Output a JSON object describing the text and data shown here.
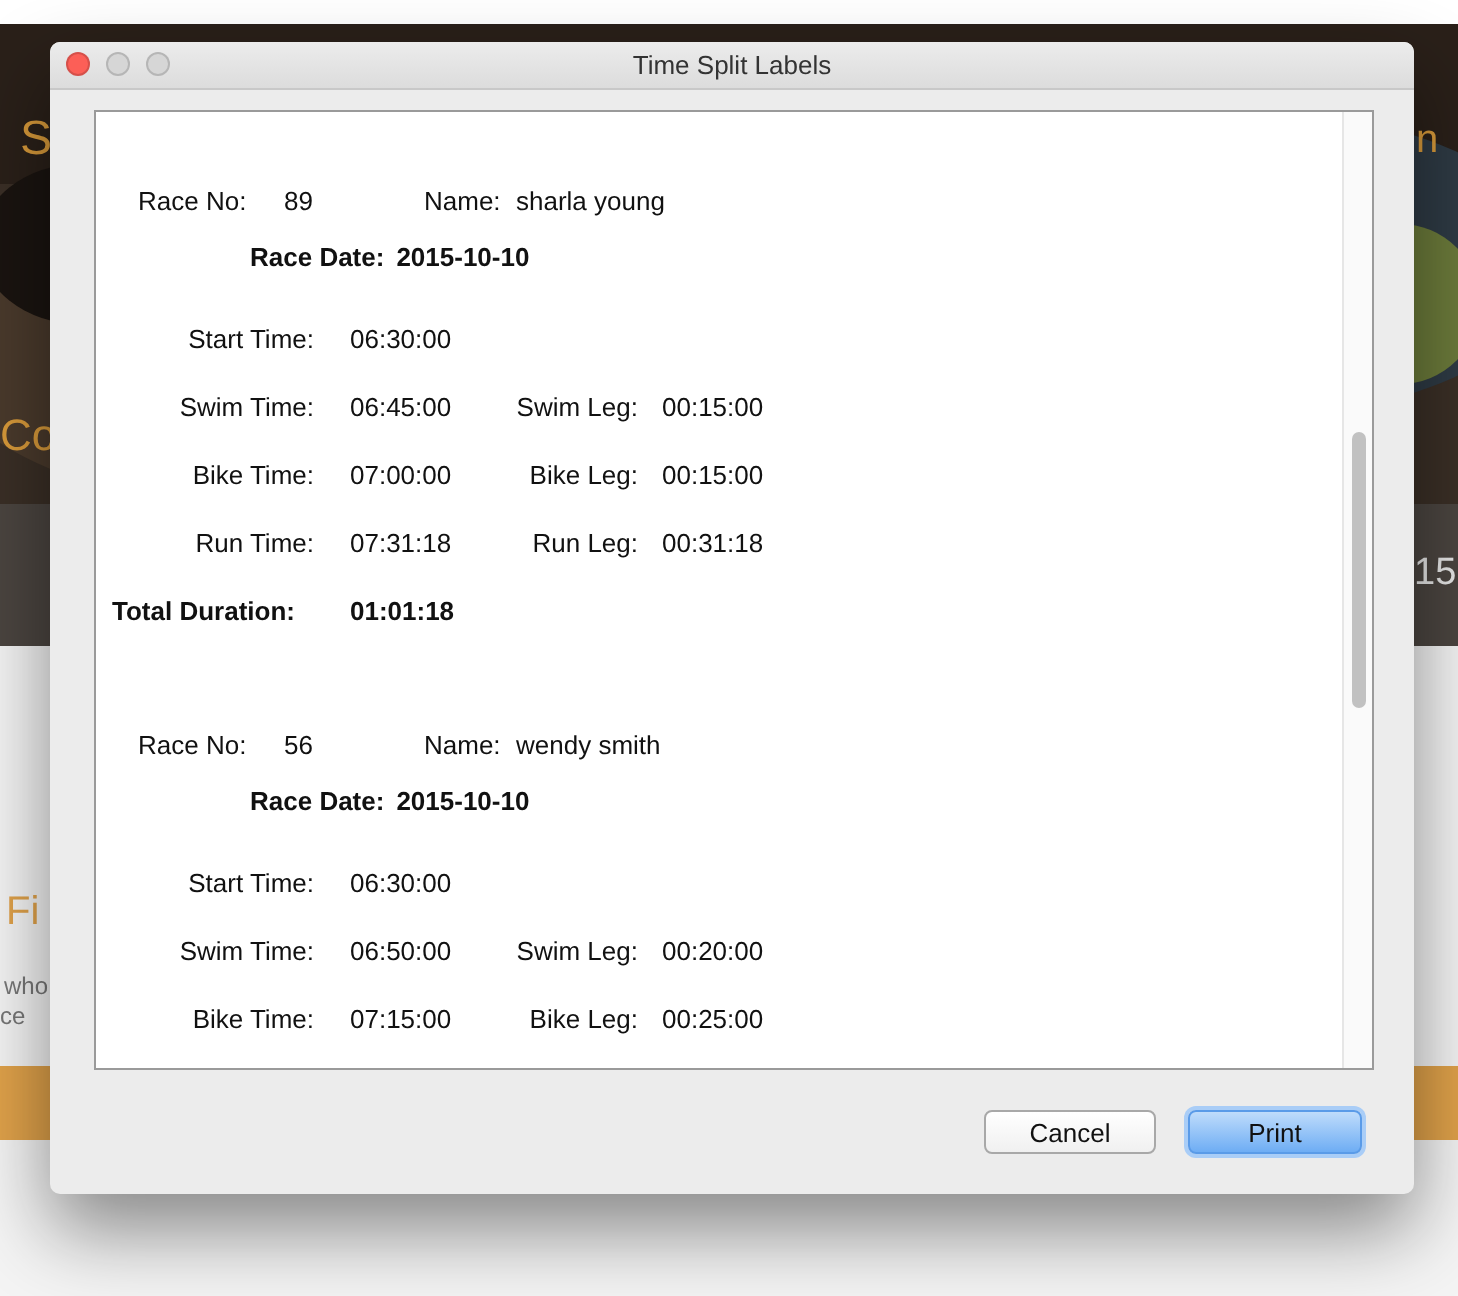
{
  "background": {
    "fragments": [
      {
        "text": "S"
      },
      {
        "text": "n"
      },
      {
        "text": "Co"
      },
      {
        "text": "15"
      },
      {
        "text": "Fi"
      },
      {
        "text": "who"
      },
      {
        "text": "ce"
      }
    ]
  },
  "window": {
    "title": "Time Split Labels"
  },
  "records": [
    {
      "race_no_label": "Race No:",
      "race_no": "89",
      "name_label": "Name:",
      "name": "sharla young",
      "date_label": "Race Date:",
      "date": "2015-10-10",
      "rows": [
        {
          "label": "Start Time:",
          "value": "06:30:00"
        },
        {
          "label": "Swim Time:",
          "value": "06:45:00",
          "leg_label": "Swim Leg:",
          "leg_value": "00:15:00"
        },
        {
          "label": "Bike Time:",
          "value": "07:00:00",
          "leg_label": "Bike Leg:",
          "leg_value": "00:15:00"
        },
        {
          "label": "Run Time:",
          "value": "07:31:18",
          "leg_label": "Run Leg:",
          "leg_value": "00:31:18"
        }
      ],
      "total": {
        "label": "Total Duration:",
        "value": "01:01:18"
      }
    },
    {
      "race_no_label": "Race No:",
      "race_no": "56",
      "name_label": "Name:",
      "name": "wendy smith",
      "date_label": "Race Date:",
      "date": "2015-10-10",
      "rows": [
        {
          "label": "Start Time:",
          "value": "06:30:00"
        },
        {
          "label": "Swim Time:",
          "value": "06:50:00",
          "leg_label": "Swim Leg:",
          "leg_value": "00:20:00"
        },
        {
          "label": "Bike Time:",
          "value": "07:15:00",
          "leg_label": "Bike Leg:",
          "leg_value": "00:25:00"
        }
      ]
    }
  ],
  "buttons": [
    {
      "label": "Cancel",
      "default": false
    },
    {
      "label": "Print",
      "default": true
    }
  ]
}
